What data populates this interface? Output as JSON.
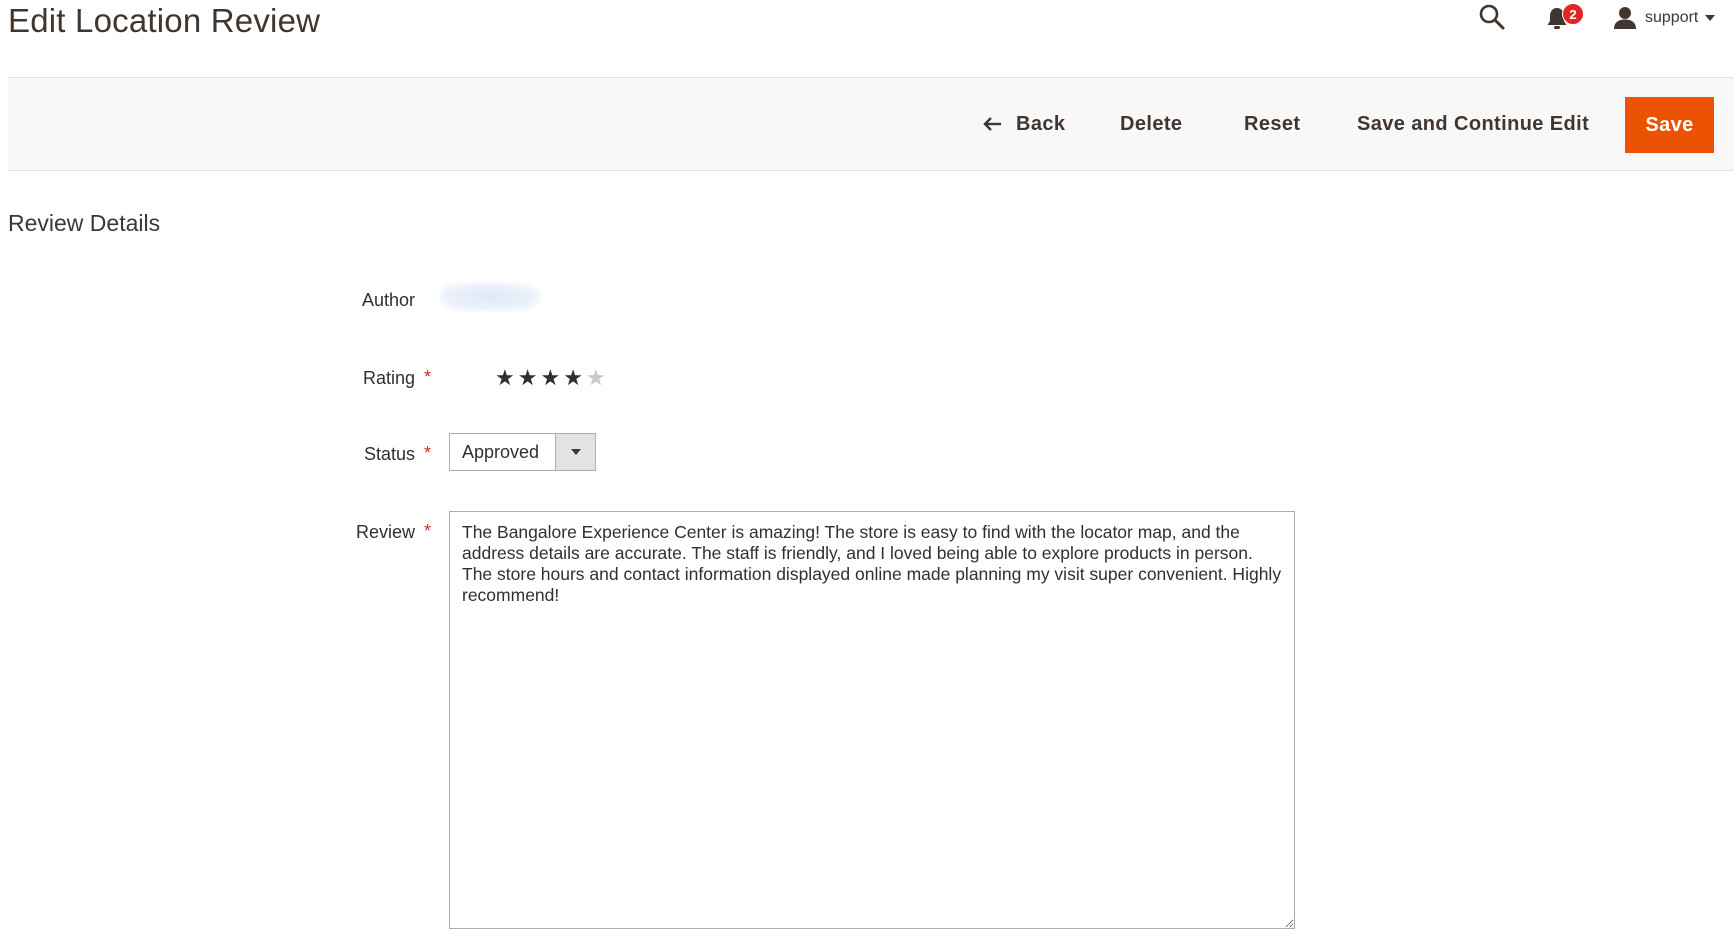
{
  "header": {
    "title": "Edit Location Review",
    "search_icon": "search-icon",
    "notifications": {
      "icon": "bell-icon",
      "count": "2"
    },
    "user": {
      "icon": "user-icon",
      "name": "support"
    }
  },
  "toolbar": {
    "back_label": "Back",
    "delete_label": "Delete",
    "reset_label": "Reset",
    "save_continue_label": "Save and Continue Edit",
    "save_label": "Save",
    "save_color": "#eb5202"
  },
  "section": {
    "title": "Review Details"
  },
  "form": {
    "author": {
      "label": "Author"
    },
    "rating": {
      "label": "Rating",
      "required": "*",
      "value": 4,
      "max": 5,
      "star_glyph": "★"
    },
    "status": {
      "label": "Status",
      "required": "*",
      "value": "Approved"
    },
    "review": {
      "label": "Review",
      "required": "*",
      "value": "The Bangalore Experience Center is amazing! The store is easy to find with the locator map, and the address details are accurate. The staff is friendly, and I loved being able to explore products in person. The store hours and contact information displayed online made planning my visit super convenient. Highly recommend!"
    }
  }
}
